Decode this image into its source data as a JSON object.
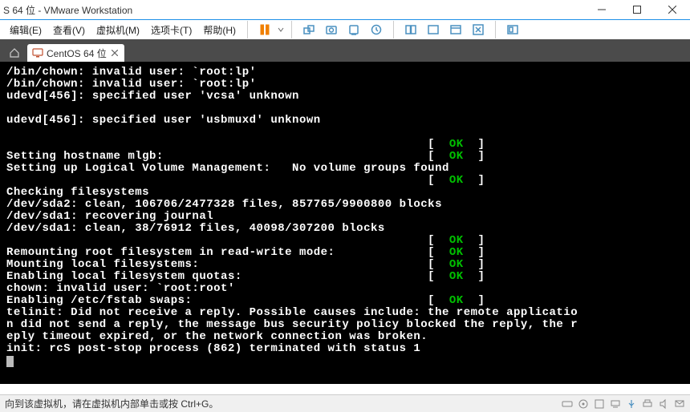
{
  "window": {
    "title": "S 64 位 - VMware Workstation"
  },
  "menu": {
    "edit": "编辑(E)",
    "view": "查看(V)",
    "vm": "虚拟机(M)",
    "tabs": "选项卡(T)",
    "help": "帮助(H)"
  },
  "tab": {
    "label": "CentOS 64 位"
  },
  "console": {
    "lines": [
      {
        "t": "/bin/chown: invalid user: `root:lp'"
      },
      {
        "t": "/bin/chown: invalid user: `root:lp'"
      },
      {
        "t": "udevd[456]: specified user 'vcsa' unknown"
      },
      {
        "t": ""
      },
      {
        "t": "udevd[456]: specified user 'usbmuxd' unknown"
      },
      {
        "t": ""
      },
      {
        "t": "                                                           [  ",
        "ok": "OK",
        "tail": "  ]"
      },
      {
        "t": "Setting hostname mlgb:                                     [  ",
        "ok": "OK",
        "tail": "  ]"
      },
      {
        "t": "Setting up Logical Volume Management:   No volume groups found"
      },
      {
        "t": "                                                           [  ",
        "ok": "OK",
        "tail": "  ]"
      },
      {
        "t": "Checking filesystems"
      },
      {
        "t": "/dev/sda2: clean, 106706/2477328 files, 857765/9900800 blocks"
      },
      {
        "t": "/dev/sda1: recovering journal"
      },
      {
        "t": "/dev/sda1: clean, 38/76912 files, 40098/307200 blocks"
      },
      {
        "t": "                                                           [  ",
        "ok": "OK",
        "tail": "  ]"
      },
      {
        "t": "Remounting root filesystem in read-write mode:             [  ",
        "ok": "OK",
        "tail": "  ]"
      },
      {
        "t": "Mounting local filesystems:                                [  ",
        "ok": "OK",
        "tail": "  ]"
      },
      {
        "t": "Enabling local filesystem quotas:                          [  ",
        "ok": "OK",
        "tail": "  ]"
      },
      {
        "t": "chown: invalid user: `root:root'"
      },
      {
        "t": "Enabling /etc/fstab swaps:                                 [  ",
        "ok": "OK",
        "tail": "  ]"
      },
      {
        "t": "telinit: Did not receive a reply. Possible causes include: the remote applicatio"
      },
      {
        "t": "n did not send a reply, the message bus security policy blocked the reply, the r"
      },
      {
        "t": "eply timeout expired, or the network connection was broken."
      },
      {
        "t": "init: rcS post-stop process (862) terminated with status 1"
      }
    ]
  },
  "status": {
    "text": "向到该虚拟机，请在虚拟机内部单击或按 Ctrl+G。"
  }
}
